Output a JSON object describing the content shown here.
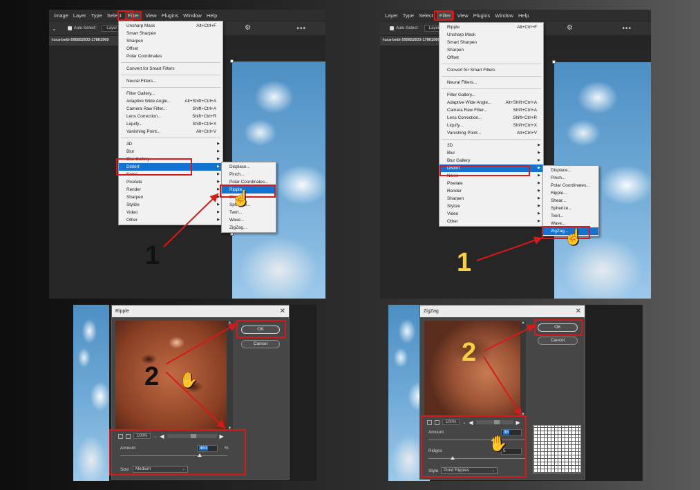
{
  "panel_tl": {
    "menubar": [
      "Image",
      "Layer",
      "Type",
      "Select",
      "Filter",
      "View",
      "Plugins",
      "Window",
      "Help"
    ],
    "options": {
      "auto_select": "Auto-Select:",
      "layer_dd": "Layer"
    },
    "doc_tab": "-luca-betti-595852633-17881969",
    "filter_menu": [
      {
        "label": "Unsharp Mask",
        "shortcut": "Alt+Ctrl+F"
      },
      {
        "label": "Smart Sharpen"
      },
      {
        "label": "Sharpen"
      },
      {
        "label": "Offset"
      },
      {
        "label": "Polar Coordinates"
      },
      {
        "sep": true
      },
      {
        "label": "Convert for Smart Filters"
      },
      {
        "sep": true
      },
      {
        "label": "Neural Filters..."
      },
      {
        "sep": true
      },
      {
        "label": "Filter Gallery..."
      },
      {
        "label": "Adaptive Wide Angle...",
        "shortcut": "Alt+Shift+Ctrl+A"
      },
      {
        "label": "Camera Raw Filter...",
        "shortcut": "Shift+Ctrl+A"
      },
      {
        "label": "Lens Correction...",
        "shortcut": "Shift+Ctrl+R"
      },
      {
        "label": "Liquify...",
        "shortcut": "Shift+Ctrl+X"
      },
      {
        "label": "Vanishing Point...",
        "shortcut": "Alt+Ctrl+V"
      },
      {
        "sep": true
      },
      {
        "label": "3D",
        "sub": true
      },
      {
        "label": "Blur",
        "sub": true
      },
      {
        "label": "Blur Gallery",
        "sub": true
      },
      {
        "label": "Distort",
        "sub": true,
        "hl": true
      },
      {
        "label": "Noise",
        "sub": true
      },
      {
        "label": "Pixelate",
        "sub": true
      },
      {
        "label": "Render",
        "sub": true
      },
      {
        "label": "Sharpen",
        "sub": true
      },
      {
        "label": "Stylize",
        "sub": true
      },
      {
        "label": "Video",
        "sub": true
      },
      {
        "label": "Other",
        "sub": true
      }
    ],
    "submenu": [
      {
        "label": "Displace..."
      },
      {
        "label": "Pinch..."
      },
      {
        "label": "Polar Coordinates..."
      },
      {
        "label": "Ripple...",
        "hl": true
      },
      {
        "label": "Shear..."
      },
      {
        "label": "Spherize..."
      },
      {
        "label": "Twirl..."
      },
      {
        "label": "Wave..."
      },
      {
        "label": "ZigZag..."
      }
    ],
    "step": "1"
  },
  "panel_tr": {
    "menubar": [
      "Layer",
      "Type",
      "Select",
      "Filter",
      "View",
      "Plugins",
      "Window",
      "Help"
    ],
    "options": {
      "auto_select": "Auto-Select:",
      "layer_dd": "Layer"
    },
    "doc_tab": "-luca-betti-595852633-17881969",
    "filter_menu": [
      {
        "label": "Ripple",
        "shortcut": "Alt+Ctrl+F"
      },
      {
        "label": "Unsharp Mask"
      },
      {
        "label": "Smart Sharpen"
      },
      {
        "label": "Sharpen"
      },
      {
        "label": "Offset"
      },
      {
        "sep": true
      },
      {
        "label": "Convert for Smart Filters"
      },
      {
        "sep": true
      },
      {
        "label": "Neural Filters..."
      },
      {
        "sep": true
      },
      {
        "label": "Filter Gallery..."
      },
      {
        "label": "Adaptive Wide Angle...",
        "shortcut": "Alt+Shift+Ctrl+A"
      },
      {
        "label": "Camera Raw Filter...",
        "shortcut": "Shift+Ctrl+A"
      },
      {
        "label": "Lens Correction...",
        "shortcut": "Shift+Ctrl+R"
      },
      {
        "label": "Liquify...",
        "shortcut": "Shift+Ctrl+X"
      },
      {
        "label": "Vanishing Point...",
        "shortcut": "Alt+Ctrl+V"
      },
      {
        "sep": true
      },
      {
        "label": "3D",
        "sub": true
      },
      {
        "label": "Blur",
        "sub": true
      },
      {
        "label": "Blur Gallery",
        "sub": true
      },
      {
        "label": "Distort",
        "sub": true,
        "hl": true
      },
      {
        "label": "Noise",
        "sub": true
      },
      {
        "label": "Pixelate",
        "sub": true
      },
      {
        "label": "Render",
        "sub": true
      },
      {
        "label": "Sharpen",
        "sub": true
      },
      {
        "label": "Stylize",
        "sub": true
      },
      {
        "label": "Video",
        "sub": true
      },
      {
        "label": "Other",
        "sub": true
      }
    ],
    "submenu": [
      {
        "label": "Displace..."
      },
      {
        "label": "Pinch..."
      },
      {
        "label": "Polar Coordinates..."
      },
      {
        "label": "Ripple..."
      },
      {
        "label": "Shear..."
      },
      {
        "label": "Spherize..."
      },
      {
        "label": "Twirl..."
      },
      {
        "label": "Wave..."
      },
      {
        "label": "ZigZag...",
        "hl": true
      }
    ],
    "step": "1"
  },
  "ripple_dialog": {
    "title": "Ripple",
    "ok": "OK",
    "cancel": "Cancel",
    "zoom": "100%",
    "amount_label": "Amount",
    "amount_value": "463",
    "amount_unit": "%",
    "size_label": "Size",
    "size_value": "Medium",
    "step": "2"
  },
  "zigzag_dialog": {
    "title": "ZigZag",
    "ok": "OK",
    "cancel": "Cancel",
    "zoom": "100%",
    "amount_label": "Amount",
    "amount_value": "38",
    "ridges_label": "Ridges",
    "ridges_value": "5",
    "style_label": "Style",
    "style_value": "Pond Ripples",
    "step": "2"
  },
  "colors": {
    "highlight": "#1473d0",
    "annotation_red": "#d61a1a",
    "step_yellow": "#f6d143"
  },
  "icons": [
    "close-icon",
    "hand-cursor-icon",
    "checkbox-icon",
    "gear-icon"
  ]
}
